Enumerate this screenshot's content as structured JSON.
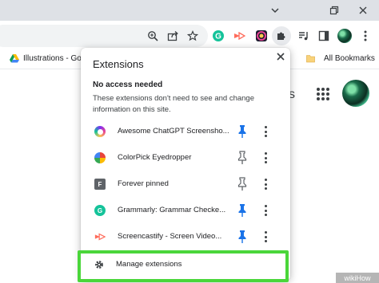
{
  "window": {
    "minimize_glyph": "⌄",
    "restore_glyph": "❐",
    "close_glyph": "✕"
  },
  "toolbar": {
    "icons": [
      "zoom-icon",
      "share-icon",
      "bookmark-star-icon",
      "grammarly-icon",
      "screencastify-icon",
      "colorpick-icon",
      "extensions-puzzle-icon",
      "reading-list-icon",
      "side-panel-icon",
      "profile-avatar"
    ]
  },
  "bookmarks_bar": {
    "item_label": "Illustrations - Go",
    "all_bookmarks_label": "All Bookmarks"
  },
  "page": {
    "partial_text": "s"
  },
  "extensions_popup": {
    "title": "Extensions",
    "close_glyph": "✕",
    "section_heading": "No access needed",
    "section_description": "These extensions don't need to see and change information on this site.",
    "items": [
      {
        "name": "Awesome ChatGPT Screensho...",
        "pinned": true,
        "icon_color": "#7b2ff7",
        "icon_letter": ""
      },
      {
        "name": "ColorPick Eyedropper",
        "pinned": false,
        "icon_color": "#e8453c",
        "icon_letter": ""
      },
      {
        "name": "Forever pinned",
        "pinned": false,
        "icon_color": "#5f6368",
        "icon_letter": "F"
      },
      {
        "name": "Grammarly: Grammar Checke...",
        "pinned": true,
        "icon_color": "#15c39a",
        "icon_letter": "G"
      },
      {
        "name": "Screencastify - Screen Video...",
        "pinned": true,
        "icon_color": "#ff6b5a",
        "icon_letter": ""
      }
    ],
    "manage_label": "Manage extensions"
  },
  "watermark": "wikiHow",
  "colors": {
    "pin_active": "#1a73e8",
    "pin_inactive": "#5f6368",
    "highlight": "#4ad63a"
  }
}
